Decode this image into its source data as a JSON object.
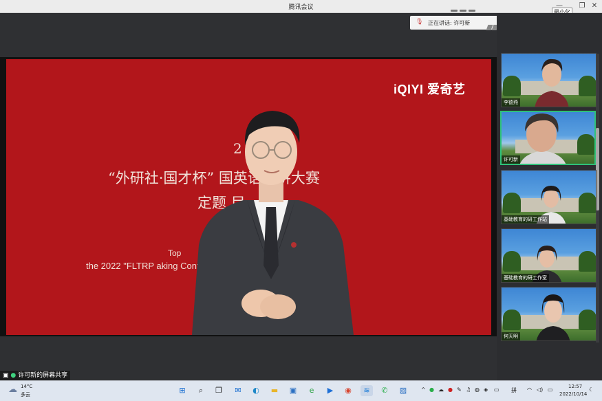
{
  "window": {
    "title": "腾讯会议",
    "minimize_tooltip": "最小化",
    "controls": {
      "minimize": "—",
      "restore": "❐",
      "close": "✕"
    }
  },
  "speaking_indicator": {
    "text": "正在讲话: 许可新"
  },
  "slide": {
    "logo": "iQIYI 爱奇艺",
    "line1": "2",
    "line2": "“外研社·国才杯”        国英语演讲大赛",
    "line3": "定题            目",
    "line4": "Top",
    "line5": "the 2022 \"FLTRP                                              aking Contest"
  },
  "share_label": "许可新的屏幕共享",
  "participants": [
    {
      "name": "李德燕",
      "mic": "muted"
    },
    {
      "name": "许可新",
      "mic": "on",
      "active": true
    },
    {
      "name": "基础教育的研工作站",
      "mic": "muted"
    },
    {
      "name": "基础教育的研工作室",
      "mic": "muted"
    },
    {
      "name": "何天明",
      "mic": "muted"
    }
  ],
  "taskbar": {
    "weather_temp": "14°C",
    "weather_desc": "多云",
    "ime": "拼",
    "time": "12:57",
    "date": "2022/10/14",
    "icons": [
      "start-icon",
      "search-icon",
      "taskview-icon",
      "mail-icon",
      "edge-icon",
      "folder-icon",
      "store-icon",
      "ie-icon",
      "tencent-meeting-icon",
      "chrome-icon",
      "meeting-icon",
      "wechat-icon",
      "photo-icon"
    ]
  },
  "colors": {
    "slide_bg": "#b2161b",
    "active_border": "#2fc27a"
  }
}
